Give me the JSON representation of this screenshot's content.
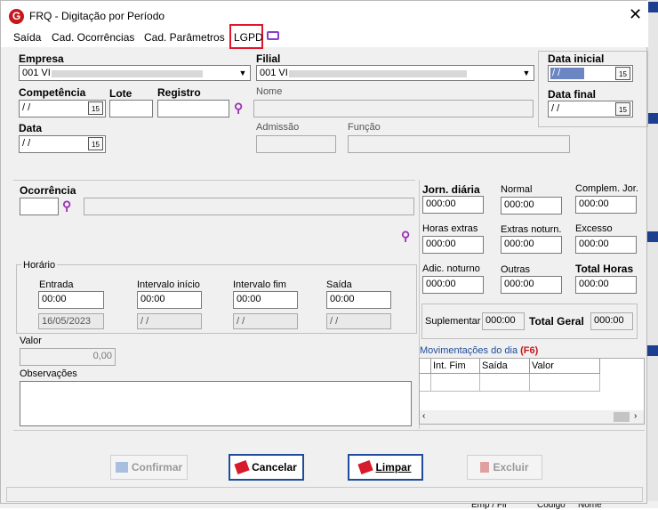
{
  "window": {
    "title": "FRQ - Digitação por Período"
  },
  "menu": {
    "saida": "Saída",
    "cad_ocorrencias": "Cad. Ocorrências",
    "cad_parametros": "Cad. Parâmetros",
    "lgpd": "LGPD"
  },
  "empresa": {
    "label": "Empresa",
    "value": "001 VI"
  },
  "filial": {
    "label": "Filial",
    "value": "001 VI"
  },
  "data_inicial": {
    "label": "Data inicial",
    "value": " / /"
  },
  "data_final": {
    "label": "Data final",
    "value": " / /"
  },
  "competencia": {
    "label": "Competência",
    "value": " / /"
  },
  "lote": {
    "label": "Lote",
    "value": ""
  },
  "registro": {
    "label": "Registro",
    "value": ""
  },
  "nome": {
    "label": "Nome",
    "value": ""
  },
  "data": {
    "label": "Data",
    "value": " / /"
  },
  "admissao": {
    "label": "Admissão",
    "value": ""
  },
  "funcao": {
    "label": "Função",
    "value": ""
  },
  "ocorrencia": {
    "label": "Ocorrência"
  },
  "horario": {
    "label": "Horário",
    "entrada": {
      "label": "Entrada",
      "value": "00:00",
      "date": "16/05/2023"
    },
    "intervalo_inicio": {
      "label": "Intervalo início",
      "value": "00:00",
      "date": " / /"
    },
    "intervalo_fim": {
      "label": "Intervalo fim",
      "value": "00:00",
      "date": " / /"
    },
    "saida": {
      "label": "Saída",
      "value": "00:00",
      "date": " / /"
    }
  },
  "valor": {
    "label": "Valor",
    "value": "0,00"
  },
  "observacoes": {
    "label": "Observações"
  },
  "jornada": {
    "jorn_diaria": {
      "label": "Jorn. diária",
      "value": "000:00"
    },
    "normal": {
      "label": "Normal",
      "value": "000:00"
    },
    "complem": {
      "label": "Complem. Jor.",
      "value": "000:00"
    },
    "horas_extras": {
      "label": "Horas extras",
      "value": "000:00"
    },
    "extras_noturn": {
      "label": "Extras noturn.",
      "value": "000:00"
    },
    "excesso": {
      "label": "Excesso",
      "value": "000:00"
    },
    "adic_noturno": {
      "label": "Adic. noturno",
      "value": "000:00"
    },
    "outras": {
      "label": "Outras",
      "value": "000:00"
    },
    "total_horas": {
      "label": "Total Horas",
      "value": "000:00"
    },
    "suplementar": {
      "label": "Suplementar",
      "value": "000:00"
    },
    "total_geral": {
      "label": "Total Geral",
      "value": "000:00"
    }
  },
  "movimentacoes": {
    "label": "Movimentações do dia",
    "shortcut": "(F6)",
    "columns": [
      "Int. Fim",
      "Saída",
      "Valor"
    ]
  },
  "buttons": {
    "confirmar": "Confirmar",
    "cancelar": "Cancelar",
    "limpar": "Limpar",
    "excluir": "Excluir"
  },
  "background": {
    "col1": "Emp / Fil",
    "col2": "Código",
    "col3": "Nome"
  },
  "colors": {
    "accent": "#1e4c9a",
    "highlight": "#e0142b",
    "search": "#9c2db5",
    "brand": "#c8161d"
  }
}
